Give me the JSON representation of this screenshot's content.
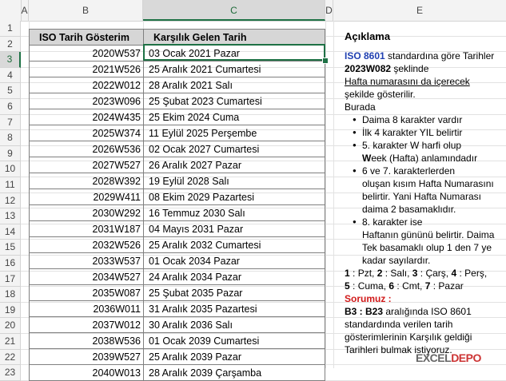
{
  "columns": [
    "A",
    "B",
    "C",
    "D",
    "E"
  ],
  "active_column": "C",
  "rows": [
    "1",
    "2",
    "3",
    "4",
    "5",
    "6",
    "7",
    "8",
    "9",
    "10",
    "11",
    "12",
    "13",
    "14",
    "15",
    "16",
    "17",
    "18",
    "19",
    "20",
    "21",
    "22",
    "23"
  ],
  "active_row": "3",
  "table": {
    "headers": [
      "ISO Tarih Gösterim",
      "Karşılık Gelen Tarih"
    ],
    "data": [
      [
        "2020W537",
        "03 Ocak 2021 Pazar"
      ],
      [
        "2021W526",
        "25 Aralık 2021 Cumartesi"
      ],
      [
        "2022W012",
        "28 Aralık 2021 Salı"
      ],
      [
        "2023W096",
        "25 Şubat 2023 Cumartesi"
      ],
      [
        "2024W435",
        "25 Ekim 2024 Cuma"
      ],
      [
        "2025W374",
        "11 Eylül 2025 Perşembe"
      ],
      [
        "2026W536",
        "02 Ocak 2027 Cumartesi"
      ],
      [
        "2027W527",
        "26 Aralık 2027 Pazar"
      ],
      [
        "2028W392",
        "19 Eylül 2028 Salı"
      ],
      [
        "2029W411",
        "08 Ekim 2029 Pazartesi"
      ],
      [
        "2030W292",
        "16 Temmuz 2030 Salı"
      ],
      [
        "2031W187",
        "04 Mayıs 2031 Pazar"
      ],
      [
        "2032W526",
        "25 Aralık 2032 Cumartesi"
      ],
      [
        "2033W537",
        "01 Ocak 2034 Pazar"
      ],
      [
        "2034W527",
        "24 Aralık 2034 Pazar"
      ],
      [
        "2035W087",
        "25 Şubat 2035 Pazar"
      ],
      [
        "2036W011",
        "31 Aralık 2035 Pazartesi"
      ],
      [
        "2037W012",
        "30 Aralık 2036 Salı"
      ],
      [
        "2038W536",
        "01 Ocak 2039 Cumartesi"
      ],
      [
        "2039W527",
        "25 Aralık 2039 Pazar"
      ],
      [
        "2040W013",
        "28 Aralık 2039 Çarşamba"
      ]
    ]
  },
  "description": {
    "title": "Açıklama",
    "p1_a": "ISO 8601",
    "p1_b": " standardına göre Tarihler ",
    "p1_c": "2023W082",
    "p1_d": " şeklinde",
    "p1_e": "Hafta numarasını da içerecek",
    "p1_f": "şekilde gösterilir.",
    "burada": "Burada",
    "bullet1": "Daima 8 karakter vardır",
    "bullet2": "İlk 4 karakter YIL belirtir",
    "bullet3_a": "5. karakter W harfi olup",
    "bullet3_b": "W",
    "bullet3_c": "eek (Hafta) anlamındadır",
    "bullet4_a": "6 ve 7. karakterlerden",
    "bullet4_b": "oluşan kısım Hafta Numarasını belirtir. Yani Hafta Numarası daima 2 basamaklıdır.",
    "bullet5_a": "8. karakter ise",
    "bullet5_b": "Haftanın gününü belirtir. Daima Tek basamaklı olup 1 den 7 ye kadar sayılardır.",
    "days_line1": [
      [
        "1",
        " : Pzt, "
      ],
      [
        "2",
        " : Salı, "
      ],
      [
        "3",
        " : Çarş, "
      ],
      [
        "4",
        " : Perş,"
      ]
    ],
    "days_line2": [
      [
        "5",
        " : Cuma, "
      ],
      [
        "6",
        " : Cmt, "
      ],
      [
        "7",
        " : Pazar"
      ]
    ],
    "question_title": "Sorumuz :",
    "question_a": "B3 : B23",
    "question_b": " aralığında ISO 8601 standardında verilen tarih gösterimlerinin Karşılık geldiği Tarihleri bulmak istiyoruz."
  },
  "logo": {
    "a": "EXCEL",
    "b": "DEPO"
  }
}
